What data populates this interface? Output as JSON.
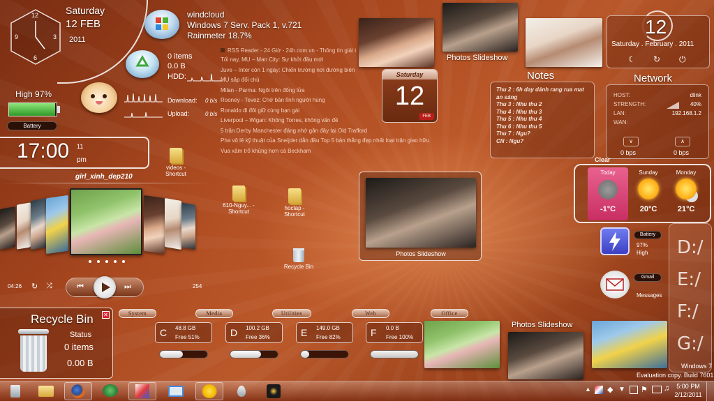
{
  "clock_widget": {
    "hour_labels": [
      "12",
      "3",
      "6",
      "9"
    ],
    "day": "Saturday",
    "date": "12 FEB",
    "year": "2011"
  },
  "system_info": {
    "hostname": "windcloud",
    "os": "Windows 7 Serv. Pack 1, v.721",
    "rainmeter": "Rainmeter 18.7%"
  },
  "recycle_mini": {
    "items": "0 items",
    "size": "0.0 B",
    "hdd_label": "HDD:"
  },
  "network_traffic": {
    "download_label": "Download:",
    "download_value": "0 b/s",
    "upload_label": "Upload:",
    "upload_value": "0 b/s"
  },
  "battery_widget": {
    "high_text": "High 97%",
    "percent": 97,
    "label": "Battery"
  },
  "digital_clock": {
    "time": "17:00",
    "day_num": "11",
    "ampm": "pm"
  },
  "album_title": "girl_xinh_dep210",
  "player": {
    "elapsed": "04:26",
    "track_count": "254"
  },
  "rss": {
    "header": "RSS Reader - 24 Giờ - 24h.com.vn - Thông tin giải t",
    "items": [
      "Tối nay, MU – Man City: Sự khởi đầu mới",
      "Juve – Inter còn 1 ngày: Chiến trường nơi đường biên",
      "MU sắp đổi chủ",
      "Milan - Parma: Ngôi trên đống lửa",
      "Rooney - Tevez: Chờ bản lĩnh người hùng",
      "Ronaldo đi đôi giữ cùng bạn gái",
      "Liverpool – Wigan: Không Torres, không vấn đề",
      "5 trận Derby Manchester đáng nhớ gần đây tại Old Trafford",
      "Pha vô lê kỹ thuật của Sneijder dẫn đầu Top 5 bàn thắng đẹp nhất loạt trận giao hữu",
      "Vua xâm trổ khủng hơn cả Beckham"
    ]
  },
  "calendar_card": {
    "day": "Saturday",
    "date": "12",
    "month": "FEB"
  },
  "photos_slideshow_label": "Photos Slideshow",
  "notes": {
    "title": "Notes",
    "lines": [
      "Thu 2 : 6h day dánh rang rua mat",
      "an sáng",
      "Thu 3 : Nhu thu 2",
      "Thu 4 : Nhu thu 3",
      "Thu 5 : Nhu thu 4",
      "Thu 6 : Nhu thu 5",
      "Thu 7 : Ngu?",
      "CN   : Ngu?"
    ]
  },
  "date_widget": {
    "day": "12",
    "full_date": "Saturday . February . 2011"
  },
  "network": {
    "title": "Network",
    "rows": [
      {
        "key": "HOST:",
        "value": "dlink"
      },
      {
        "key": "STRENGTH:",
        "value": "40%"
      },
      {
        "key": "LAN:",
        "value": "192.168.1.2"
      },
      {
        "key": "WAN:",
        "value": ""
      }
    ],
    "down_speed": "0 bps",
    "up_speed": "0 bps"
  },
  "weather": {
    "condition": "Clear",
    "days": [
      {
        "name": "Today",
        "temp": "-1°C"
      },
      {
        "name": "Sunday",
        "temp": "20°C"
      },
      {
        "name": "Monday",
        "temp": "21°C"
      }
    ]
  },
  "battery_launcher": {
    "label": "Battery",
    "percent": "97%",
    "level": "High"
  },
  "gmail_launcher": {
    "label": "Gmail",
    "sub": "Messages"
  },
  "drive_letters": [
    "D:/",
    "E:/",
    "F:/",
    "G:/"
  ],
  "desktop_icons": [
    {
      "label": "videos - Shortcut"
    },
    {
      "label": "610-Nguy... - Shortcut"
    },
    {
      "label": "hoctap - Shortcut"
    },
    {
      "label": "Recycle Bin"
    }
  ],
  "recycle_bin_widget": {
    "title": "Recycle Bin",
    "status": "Status",
    "items": "0 items",
    "size": "0.00 B"
  },
  "launcher_tabs": [
    "System",
    "Media",
    "Utilities",
    "Web",
    "Office"
  ],
  "drives": [
    {
      "letter": "C",
      "size": "48.8 GB",
      "free": "Free 51%",
      "used_fraction": 0.49
    },
    {
      "letter": "D",
      "size": "100.2 GB",
      "free": "Free 36%",
      "used_fraction": 0.64
    },
    {
      "letter": "E",
      "size": "149.0 GB",
      "free": "Free 82%",
      "used_fraction": 0.18
    },
    {
      "letter": "F",
      "size": "0.0 B",
      "free": "Free 100%",
      "used_fraction": 0.0
    }
  ],
  "watermark": {
    "line1": "Windows 7",
    "line2": "Evaluation copy. Build 7601"
  },
  "tray_clock": {
    "time": "5:00 PM",
    "date": "2/12/2011"
  },
  "colors": {
    "accent": "#b9582a",
    "weather_today_bg": "#d8417a",
    "battery_green": "#46c03a",
    "launcher_blue": "#3c58d8"
  }
}
